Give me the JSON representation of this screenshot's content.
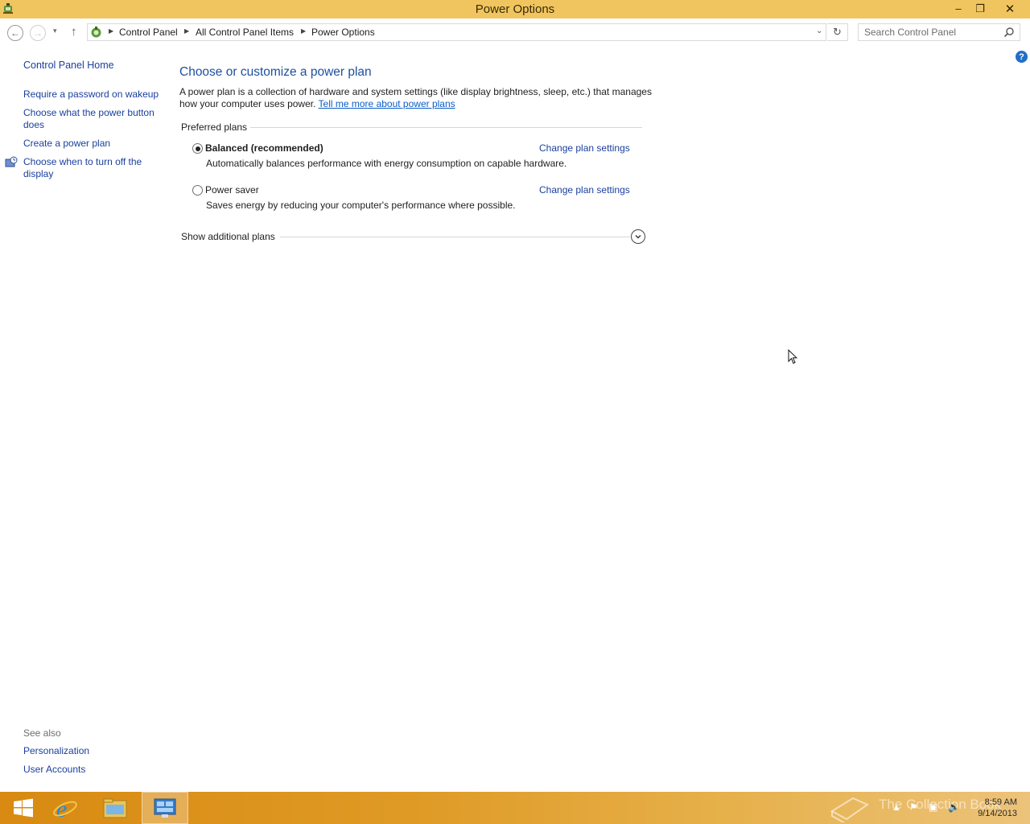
{
  "window": {
    "title": "Power Options",
    "minimize_glyph": "–",
    "maximize_glyph": "❐",
    "close_glyph": "✕"
  },
  "nav": {
    "back_glyph": "←",
    "forward_glyph": "→",
    "recent_glyph": "▾",
    "up_glyph": "↑",
    "breadcrumb": [
      "Control Panel",
      "All Control Panel Items",
      "Power Options"
    ],
    "dropdown_glyph": "⌄",
    "refresh_glyph": "↻",
    "search_placeholder": "Search Control Panel",
    "help_glyph": "?"
  },
  "sidebar": {
    "home": "Control Panel Home",
    "links": [
      "Require a password on wakeup",
      "Choose what the power button does",
      "Create a power plan",
      "Choose when to turn off the display"
    ],
    "see_also_label": "See also",
    "see_also": [
      "Personalization",
      "User Accounts"
    ]
  },
  "main": {
    "title": "Choose or customize a power plan",
    "description": "A power plan is a collection of hardware and system settings (like display brightness, sleep, etc.) that manages how your computer uses power.",
    "learn_more": "Tell me more about power plans",
    "preferred_label": "Preferred plans",
    "plans": [
      {
        "name": "Balanced (recommended)",
        "selected": true,
        "description": "Automatically balances performance with energy consumption on capable hardware.",
        "change_link": "Change plan settings"
      },
      {
        "name": "Power saver",
        "selected": false,
        "description": "Saves energy by reducing your computer's performance where possible.",
        "change_link": "Change plan settings"
      }
    ],
    "additional_label": "Show additional plans"
  },
  "taskbar": {
    "items": [
      "start-button",
      "internet-explorer",
      "file-explorer",
      "control-panel"
    ],
    "watermark": "The Collection Book",
    "time": "8:59 AM",
    "date": "9/14/2013"
  },
  "colors": {
    "titlebar": "#f0c560",
    "link": "#1a3f9d",
    "heading": "#1d4fa1",
    "taskbar": "#d88a12"
  }
}
